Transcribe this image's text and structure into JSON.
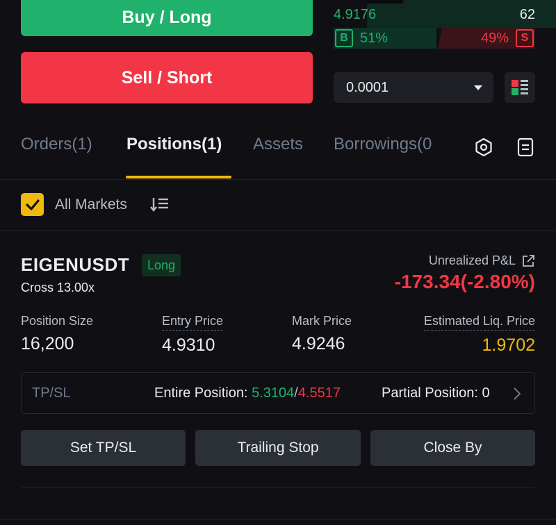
{
  "trade": {
    "buy_label": "Buy / Long",
    "sell_label": "Sell / Short"
  },
  "orderbook": {
    "price": "4.9176",
    "qty": "62",
    "buy_badge": "B",
    "buy_pct": "51%",
    "sell_pct": "49%",
    "sell_badge": "S",
    "precision": "0.0001"
  },
  "tabs": [
    {
      "label": "Orders(1)"
    },
    {
      "label": "Positions(1)"
    },
    {
      "label": "Assets"
    },
    {
      "label": "Borrowings(0"
    }
  ],
  "filter": {
    "all_markets_label": "All Markets"
  },
  "position": {
    "symbol": "EIGENUSDT",
    "side": "Long",
    "margin_mode": "Cross 13.00x",
    "upnl_label": "Unrealized P&L",
    "upnl_value": "-173.34(-2.80%)",
    "size_label": "Position Size",
    "size_value": "16,200",
    "entry_label": "Entry Price",
    "entry_value": "4.9310",
    "mark_label": "Mark Price",
    "mark_value": "4.9246",
    "liq_label": "Estimated Liq. Price",
    "liq_value": "1.9702",
    "tpsl_label": "TP/SL",
    "entire_label": "Entire Position: ",
    "tp_value": "5.3104",
    "separator": "/",
    "sl_value": "4.5517",
    "partial_label": "Partial Position: 0"
  },
  "actions": {
    "set_tpsl": "Set TP/SL",
    "trailing_stop": "Trailing Stop",
    "close_by": "Close By"
  },
  "colors": {
    "buy": "#20b26c",
    "sell": "#f23645",
    "accent": "#f0b90b",
    "background": "#101014"
  }
}
